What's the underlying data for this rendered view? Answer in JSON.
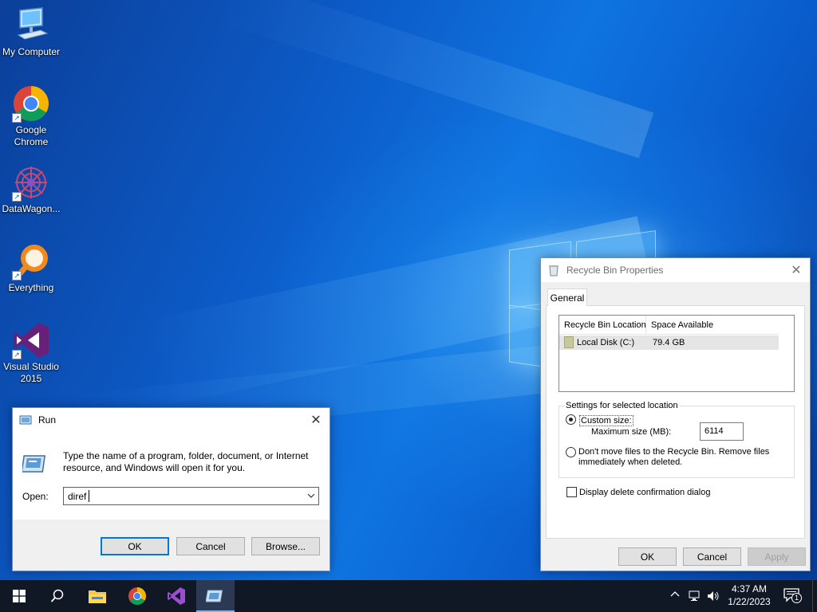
{
  "desktop": {
    "icons": [
      {
        "label": "My Computer"
      },
      {
        "label": "Google Chrome"
      },
      {
        "label": "DataWagon..."
      },
      {
        "label": "Everything"
      },
      {
        "label": "Visual Studio 2015"
      }
    ]
  },
  "run_dialog": {
    "title": "Run",
    "close_glyph": "✕",
    "description": "Type the name of a program, folder, document, or Internet resource, and Windows will open it for you.",
    "open_label": "Open:",
    "open_value": "diref",
    "ok_label": "OK",
    "cancel_label": "Cancel",
    "browse_label": "Browse..."
  },
  "recycle_dialog": {
    "title": "Recycle Bin Properties",
    "close_glyph": "✕",
    "tab_general": "General",
    "columns": [
      "Recycle Bin Location",
      "Space Available"
    ],
    "rows": [
      {
        "location": "Local Disk (C:)",
        "space": "79.4 GB"
      }
    ],
    "settings_legend": "Settings for selected location",
    "custom_size_label": "Custom size:",
    "max_size_label": "Maximum size (MB):",
    "max_size_value": "6114",
    "dont_move_label": "Don't move files to the Recycle Bin. Remove files immediately when deleted.",
    "display_confirm_label": "Display delete confirmation dialog",
    "ok_label": "OK",
    "cancel_label": "Cancel",
    "apply_label": "Apply"
  },
  "taskbar": {
    "time": "4:37 AM",
    "date": "1/22/2023",
    "notification_count": "1",
    "tray_up_glyph": "^"
  },
  "colors": {
    "accent": "#0078d7",
    "taskbar": "#101826"
  }
}
